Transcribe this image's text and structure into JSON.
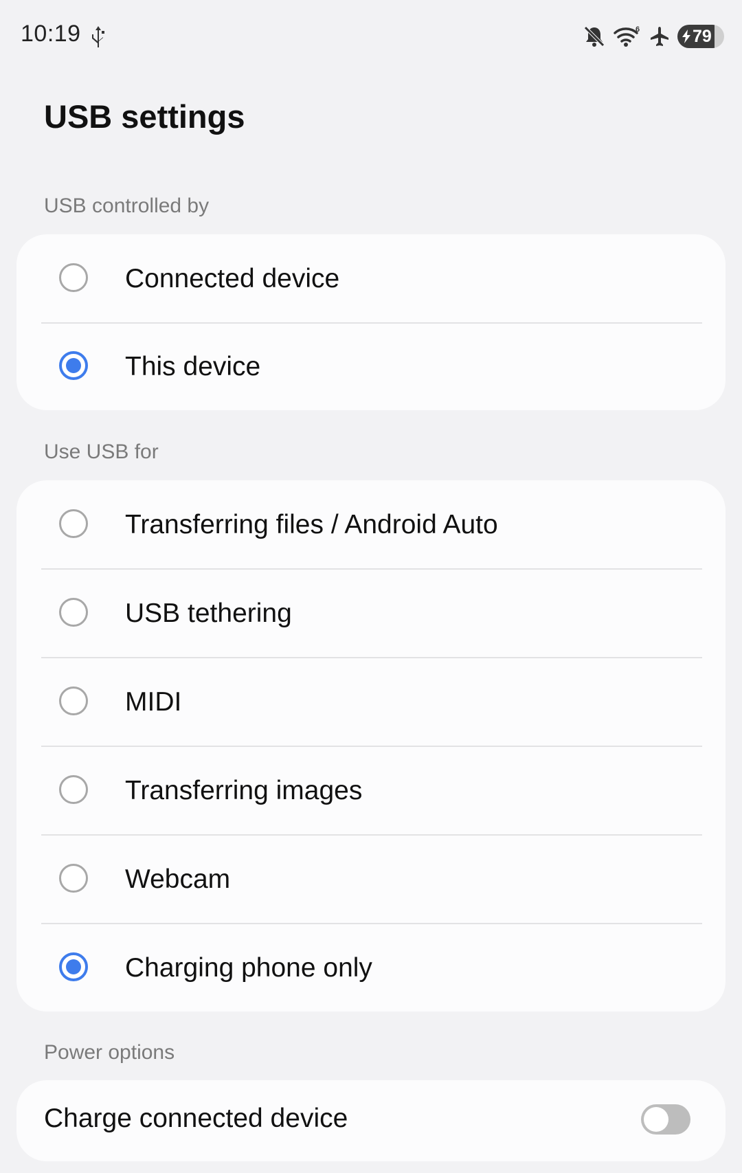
{
  "status_bar": {
    "time": "10:19",
    "battery_level": "79",
    "wifi_badge": "6",
    "icons": [
      "usb-icon",
      "mute-icon",
      "wifi-icon",
      "airplane-icon",
      "battery-icon"
    ]
  },
  "page": {
    "title": "USB settings"
  },
  "sections": {
    "controlled_by": {
      "header": "USB controlled by",
      "options": [
        {
          "label": "Connected device",
          "selected": false
        },
        {
          "label": "This device",
          "selected": true
        }
      ]
    },
    "use_for": {
      "header": "Use USB for",
      "options": [
        {
          "label": "Transferring files / Android Auto",
          "selected": false
        },
        {
          "label": "USB tethering",
          "selected": false
        },
        {
          "label": "MIDI",
          "selected": false
        },
        {
          "label": "Transferring images",
          "selected": false
        },
        {
          "label": "Webcam",
          "selected": false
        },
        {
          "label": "Charging phone only",
          "selected": true
        }
      ]
    },
    "power": {
      "header": "Power options",
      "toggle_label": "Charge connected device",
      "toggle_on": false
    }
  },
  "colors": {
    "accent": "#3e7cec",
    "background": "#f2f2f4",
    "card": "#fcfcfd",
    "section_header": "#7a7a7a"
  }
}
